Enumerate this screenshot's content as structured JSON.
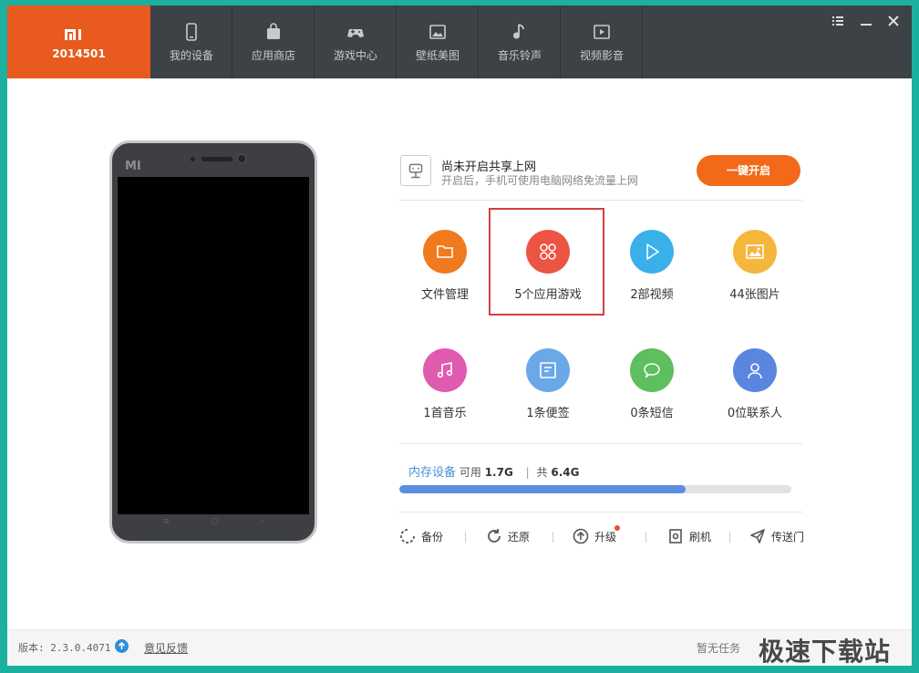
{
  "brand": {
    "device_id": "2014501",
    "logo": "mi-logo"
  },
  "nav": [
    {
      "label": "我的设备",
      "icon": "phone-icon"
    },
    {
      "label": "应用商店",
      "icon": "bag-icon"
    },
    {
      "label": "游戏中心",
      "icon": "gamepad-icon"
    },
    {
      "label": "壁纸美图",
      "icon": "picture-icon"
    },
    {
      "label": "音乐铃声",
      "icon": "music-note-icon"
    },
    {
      "label": "视频影音",
      "icon": "video-play-icon"
    }
  ],
  "window_controls": [
    "menu-icon",
    "minimize-icon",
    "close-icon"
  ],
  "phone": {
    "logo_text": "MI"
  },
  "share": {
    "title": "尚未开启共享上网",
    "desc": "开启后，手机可使用电脑网络免流量上网",
    "button": "一键开启"
  },
  "tiles": [
    {
      "label": "文件管理",
      "color": "#f07a1e",
      "icon": "folder-icon"
    },
    {
      "label": "5个应用游戏",
      "color": "#ec5444",
      "icon": "apps-grid-icon"
    },
    {
      "label": "2部视频",
      "color": "#3ab0ea",
      "icon": "play-icon"
    },
    {
      "label": "44张图片",
      "color": "#f5b63c",
      "icon": "image-icon"
    },
    {
      "label": "1首音乐",
      "color": "#e05ab0",
      "icon": "music-icon"
    },
    {
      "label": "1条便签",
      "color": "#6aa8e8",
      "icon": "note-icon"
    },
    {
      "label": "0条短信",
      "color": "#5dbf5d",
      "icon": "chat-bubble-icon"
    },
    {
      "label": "0位联系人",
      "color": "#5a86e0",
      "icon": "contact-icon"
    }
  ],
  "storage": {
    "label": "内存设备",
    "available_label": "可用",
    "available": "1.7G",
    "total_label": "共",
    "total": "6.4G",
    "used_fraction": 0.73
  },
  "actions": [
    {
      "label": "备份",
      "icon": "backup-icon"
    },
    {
      "label": "还原",
      "icon": "restore-icon"
    },
    {
      "label": "升级",
      "icon": "upgrade-icon"
    },
    {
      "label": "刷机",
      "icon": "flash-icon"
    },
    {
      "label": "传送门",
      "icon": "send-icon"
    }
  ],
  "colors": {
    "accent": "#e85a1e",
    "topbar": "#3d4246",
    "frame": "#1bb0a0",
    "badge": "#e84a3a"
  },
  "footer": {
    "version": "版本: 2.3.0.4071",
    "feedback": "意见反馈",
    "task_status": "暂无任务",
    "watermark": "极速下载站"
  }
}
